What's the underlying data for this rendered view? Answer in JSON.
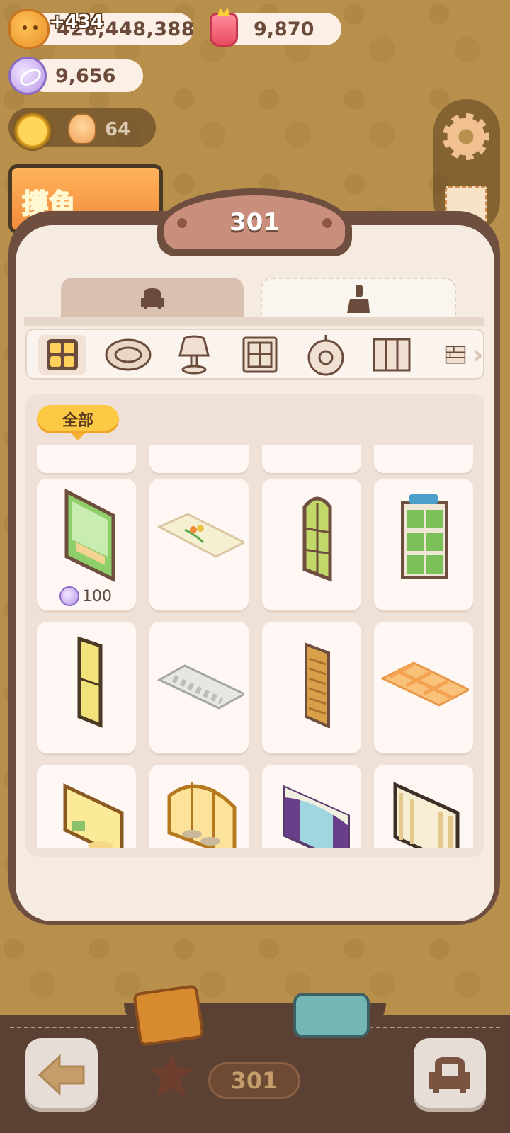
{
  "currencies": {
    "coins": "428,448,388",
    "coins_gain": "+434",
    "jam": "9,870",
    "candy": "9,656"
  },
  "player": {
    "level": "64"
  },
  "banner_text": "摸鱼",
  "panel": {
    "title": "301",
    "tabs": [
      {
        "name": "furniture",
        "icon": "armchair-icon",
        "selected": false
      },
      {
        "name": "decor",
        "icon": "broom-icon",
        "selected": true
      }
    ],
    "categories": [
      {
        "icon": "grid-icon",
        "selected": true
      },
      {
        "icon": "rug-icon"
      },
      {
        "icon": "lamp-icon"
      },
      {
        "icon": "window-icon"
      },
      {
        "icon": "wall-clock-icon"
      },
      {
        "icon": "screen-icon"
      },
      {
        "icon": "brick-wall-icon"
      }
    ],
    "filter_label": "全部",
    "items": [
      {
        "name": "forest-window",
        "price": "100"
      },
      {
        "name": "tulip-rug"
      },
      {
        "name": "arched-window"
      },
      {
        "name": "green-drawer-cabinet"
      },
      {
        "name": "slim-window"
      },
      {
        "name": "grey-pattern-rug"
      },
      {
        "name": "wooden-shutter"
      },
      {
        "name": "orange-plaid-rug"
      },
      {
        "name": "yellow-bay-window"
      },
      {
        "name": "arched-bay-window"
      },
      {
        "name": "purple-curtain-window"
      },
      {
        "name": "lace-curtain-window"
      }
    ]
  },
  "bottom": {
    "room_number": "301"
  },
  "colors": {
    "frame": "#6e4e3e",
    "panel_bg": "#f6ebe1",
    "accent_yellow": "#fcc945",
    "candy_purple": "#b795e8"
  }
}
